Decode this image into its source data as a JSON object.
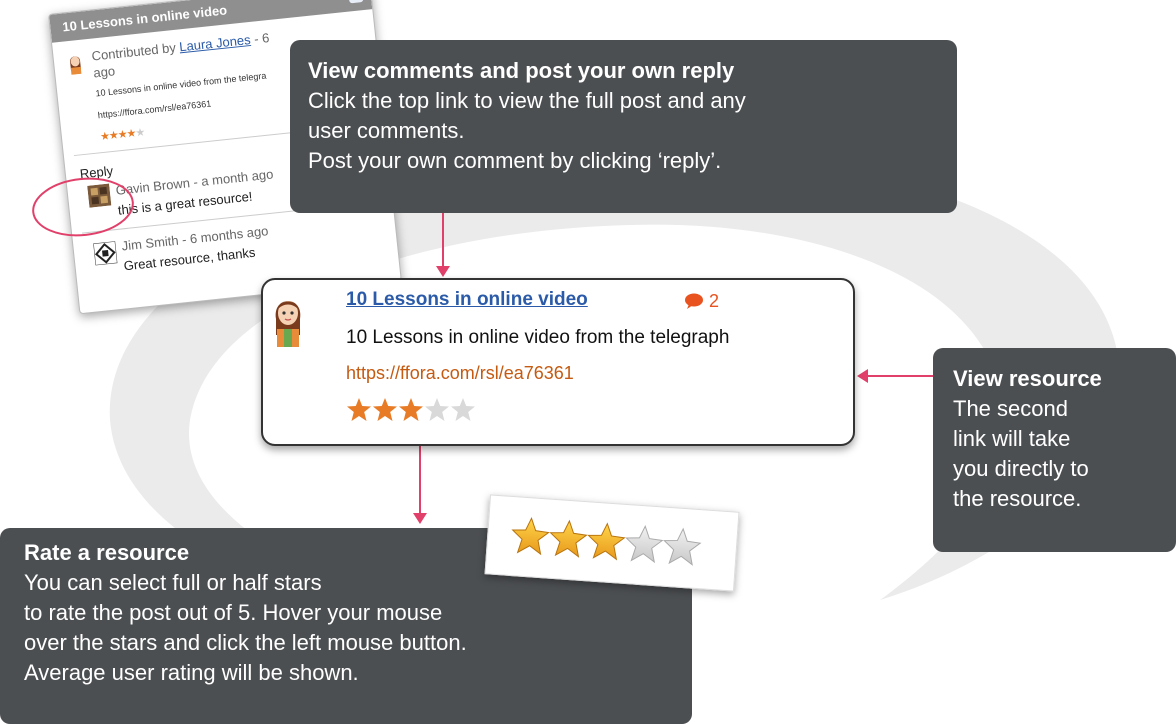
{
  "colors": {
    "callout_bg": "#4c4f52",
    "arrow": "#e0406a",
    "link_blue": "#2b5ba8",
    "url_orange": "#c55a11",
    "star_orange": "#e87b25",
    "comment_orange": "#e8531f"
  },
  "popup": {
    "title": "10 Lessons in online video",
    "close_icon": "×",
    "contributed_prefix": "Contributed by ",
    "author": "Laura Jones",
    "author_suffix": " - 6",
    "ago": "ago",
    "desc": "10 Lessons in online video from the telegra",
    "url": "https://ffora.com/rsl/ea76361",
    "rating_stars": 3.5,
    "reply_label": "Reply",
    "comments": [
      {
        "author_meta": "Gavin Brown - a month ago",
        "text": "this is a great resource!"
      },
      {
        "author_meta": "Jim Smith - 6 months ago",
        "text": "Great resource, thanks"
      }
    ]
  },
  "callout_top": {
    "heading": "View comments and post your own reply",
    "line1": "Click the top link to view the full post and any",
    "line2": "user comments.",
    "line3": "Post your own comment by clicking ‘reply’."
  },
  "card": {
    "title": "10 Lessons in online video",
    "comment_count": "2",
    "desc": "10 Lessons in online video from the telegraph",
    "url": "https://ffora.com/rsl/ea76361",
    "rating_stars": 3.5
  },
  "callout_right": {
    "heading": "View resource",
    "line1": "The second",
    "line2": "link will take",
    "line3": "you directly to",
    "line4": "the resource."
  },
  "callout_bottom": {
    "heading": "Rate a resource",
    "line1": "You can select full or half stars",
    "line2": "to rate the post out of 5. Hover your mouse",
    "line3": "over the stars and click the left mouse button.",
    "line4": "Average user rating will be shown."
  },
  "rating_example_stars": 3.5
}
